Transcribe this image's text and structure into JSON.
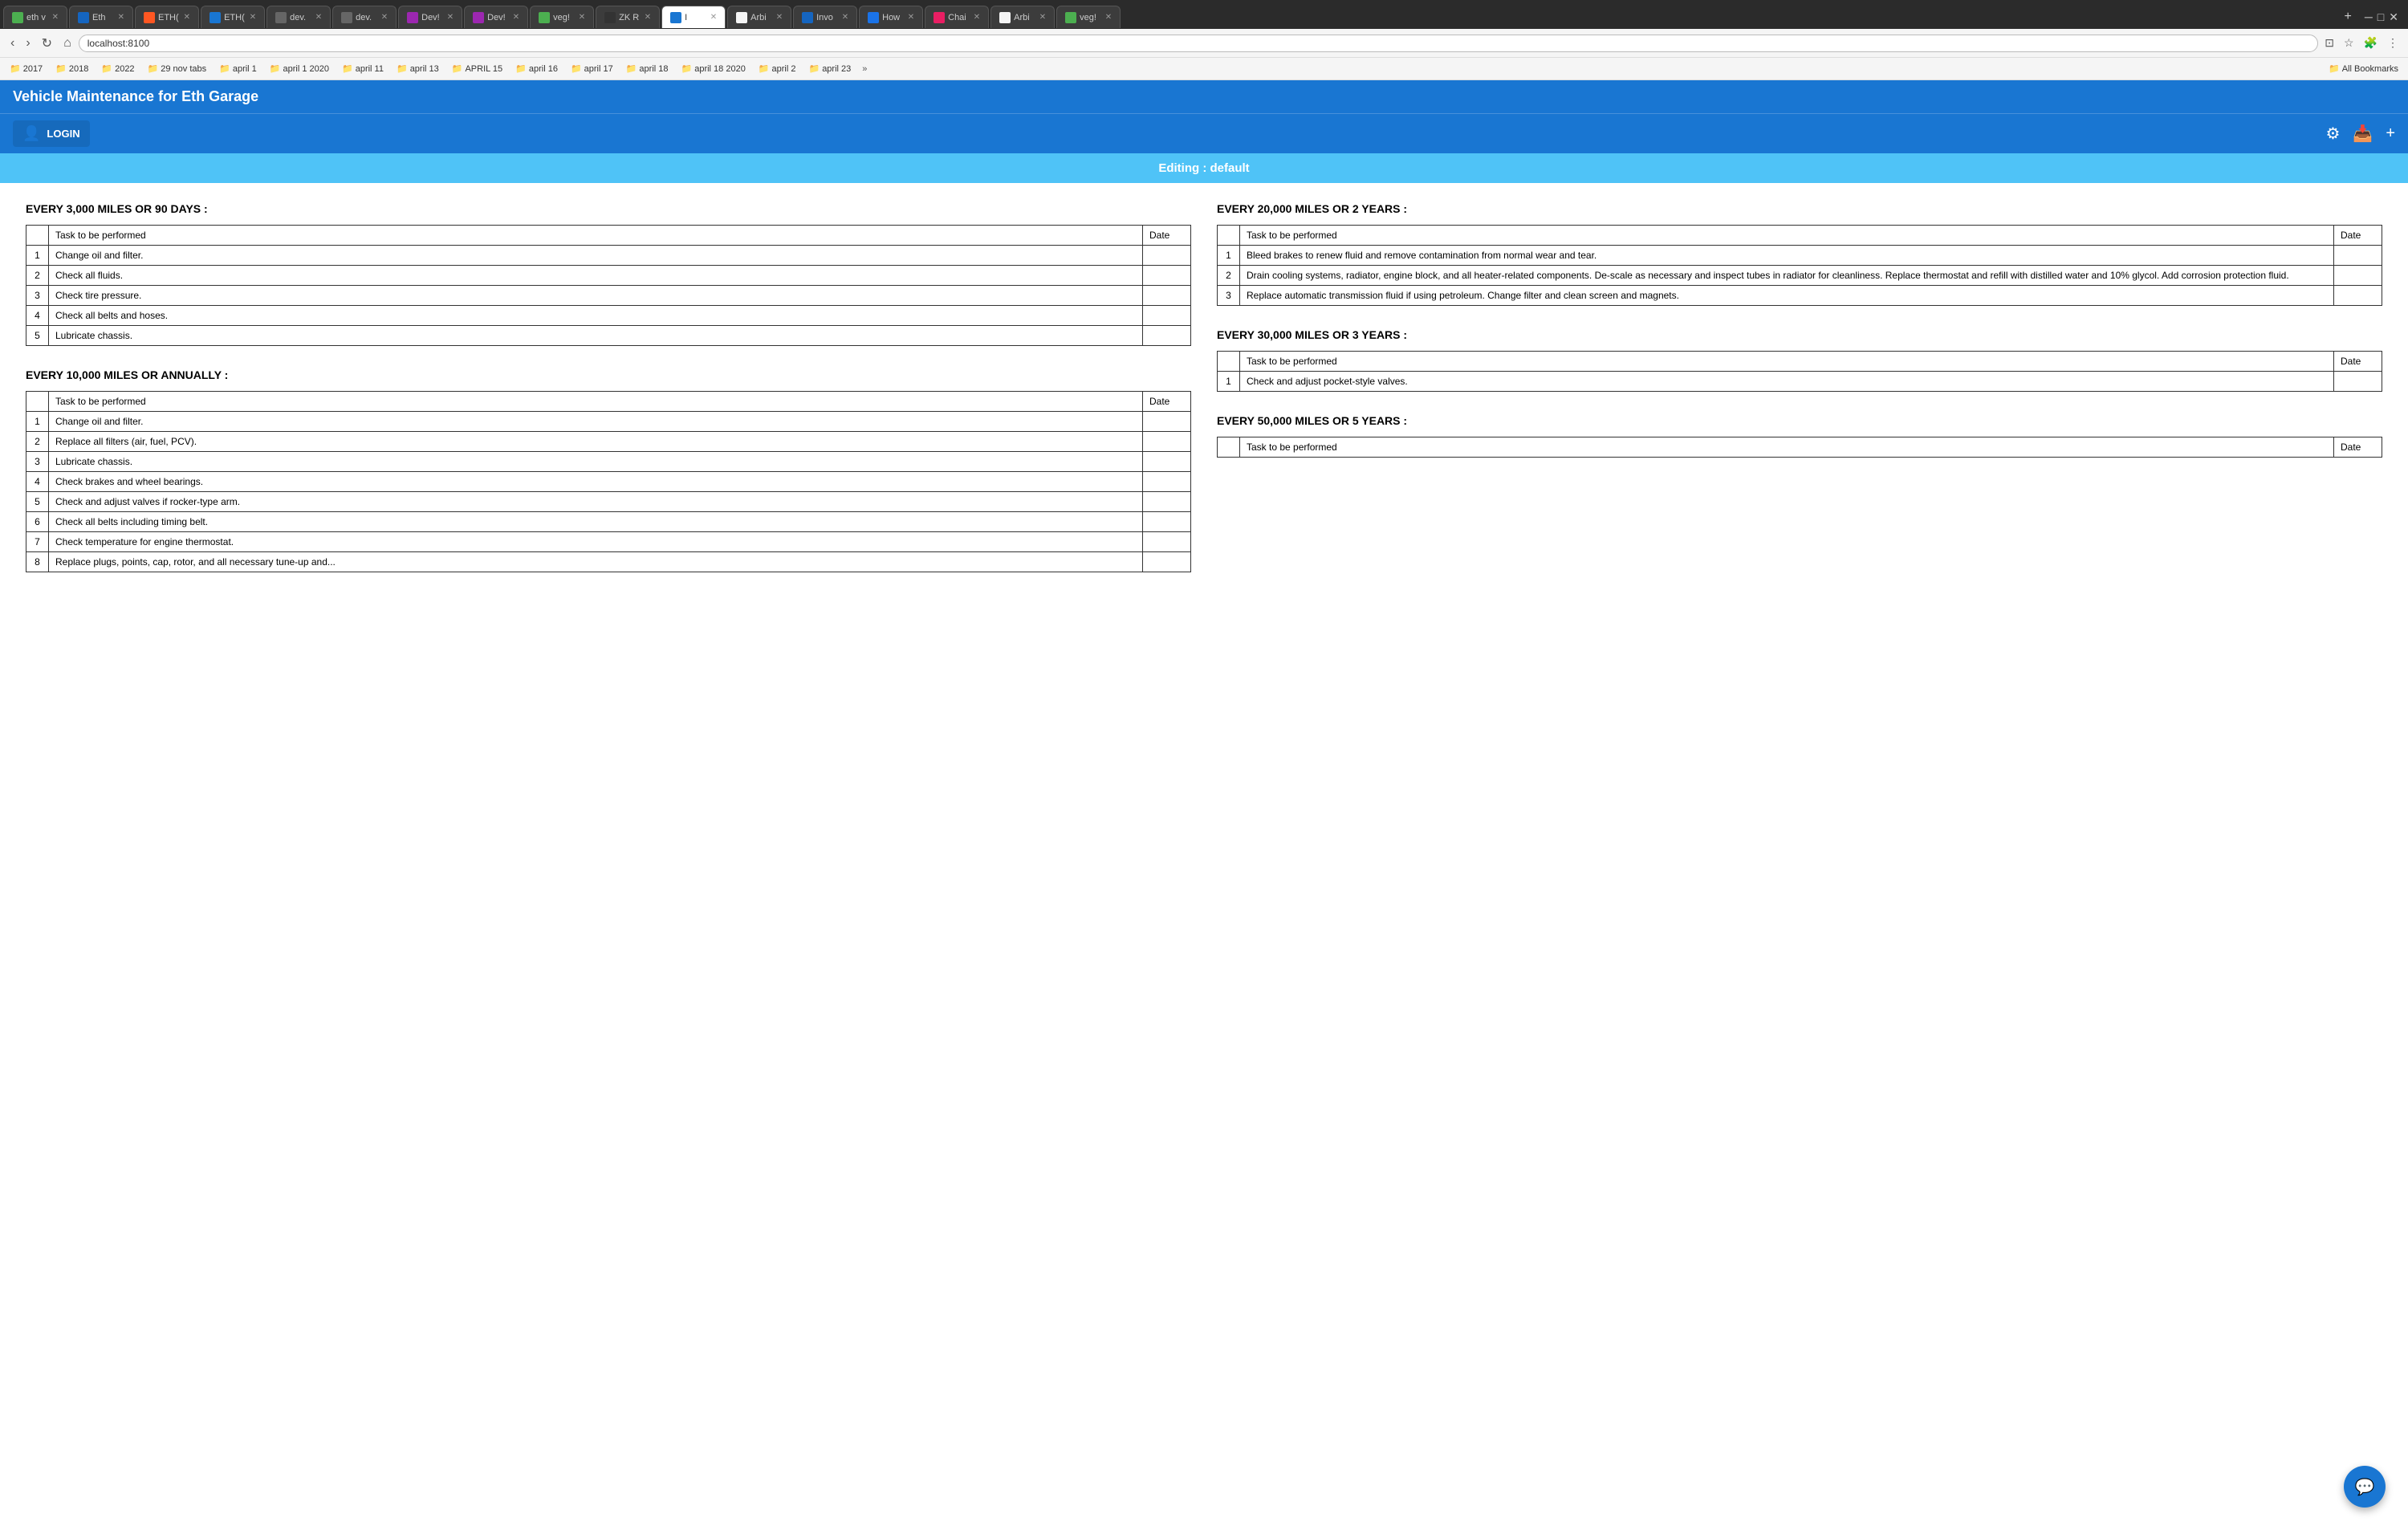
{
  "browser": {
    "tabs": [
      {
        "label": "eth v",
        "active": false,
        "favicon_color": "#4caf50"
      },
      {
        "label": "Eth",
        "active": false,
        "favicon_color": "#1565c0"
      },
      {
        "label": "ETH(",
        "active": false,
        "favicon_color": "#ff5722"
      },
      {
        "label": "ETH(",
        "active": false,
        "favicon_color": "#1976d2"
      },
      {
        "label": "dev.",
        "active": false,
        "favicon_color": "#666"
      },
      {
        "label": "dev.",
        "active": false,
        "favicon_color": "#666"
      },
      {
        "label": "Dev!",
        "active": false,
        "favicon_color": "#9c27b0"
      },
      {
        "label": "Dev!",
        "active": false,
        "favicon_color": "#9c27b0"
      },
      {
        "label": "veg!",
        "active": false,
        "favicon_color": "#4caf50"
      },
      {
        "label": "ZK R",
        "active": false,
        "favicon_color": "#333"
      },
      {
        "label": "I",
        "active": true,
        "favicon_color": "#1976d2"
      },
      {
        "label": "Arbi",
        "active": false,
        "favicon_color": "#f5f5f5"
      },
      {
        "label": "Invo",
        "active": false,
        "favicon_color": "#1565c0"
      },
      {
        "label": "How",
        "active": false,
        "favicon_color": "#1a73e8"
      },
      {
        "label": "Chai",
        "active": false,
        "favicon_color": "#e91e63"
      },
      {
        "label": "Arbi",
        "active": false,
        "favicon_color": "#f5f5f5"
      },
      {
        "label": "veg!",
        "active": false,
        "favicon_color": "#4caf50"
      }
    ],
    "address": "localhost:8100",
    "bookmarks": [
      "2017",
      "2018",
      "2022",
      "29 nov tabs",
      "april 1",
      "april 1 2020",
      "april 11",
      "april 13",
      "APRIL 15",
      "april 16",
      "april 17",
      "april 18",
      "april 18 2020",
      "april 2",
      "april 23"
    ],
    "all_bookmarks_label": "All Bookmarks"
  },
  "app": {
    "title": "Vehicle Maintenance for Eth Garage",
    "login_label": "LOGIN",
    "editing_label": "Editing : default"
  },
  "sections": [
    {
      "title": "EVERY 3,000 MILES OR 90 DAYS :",
      "headers": [
        "",
        "Task to be performed",
        "Date"
      ],
      "rows": [
        {
          "num": "1",
          "task": "Change oil and filter.",
          "date": ""
        },
        {
          "num": "2",
          "task": "Check all fluids.",
          "date": ""
        },
        {
          "num": "3",
          "task": "Check tire pressure.",
          "date": ""
        },
        {
          "num": "4",
          "task": "Check all belts and hoses.",
          "date": ""
        },
        {
          "num": "5",
          "task": "Lubricate chassis.",
          "date": ""
        }
      ]
    },
    {
      "title": "EVERY 10,000 MILES OR ANNUALLY :",
      "headers": [
        "",
        "Task to be performed",
        "Date"
      ],
      "rows": [
        {
          "num": "1",
          "task": "Change oil and filter.",
          "date": ""
        },
        {
          "num": "2",
          "task": "Replace all filters (air, fuel, PCV).",
          "date": ""
        },
        {
          "num": "3",
          "task": "Lubricate chassis.",
          "date": ""
        },
        {
          "num": "4",
          "task": "Check brakes and wheel bearings.",
          "date": ""
        },
        {
          "num": "5",
          "task": "Check and adjust valves if rocker-type arm.",
          "date": ""
        },
        {
          "num": "6",
          "task": "Check all belts including timing belt.",
          "date": ""
        },
        {
          "num": "7",
          "task": "Check temperature for engine thermostat.",
          "date": ""
        },
        {
          "num": "8",
          "task": "Replace plugs, points, cap, rotor, and all necessary tune-up and...",
          "date": ""
        }
      ]
    },
    {
      "title": "EVERY 20,000 MILES OR 2 YEARS :",
      "headers": [
        "",
        "Task to be performed",
        "Date"
      ],
      "rows": [
        {
          "num": "1",
          "task": "Bleed brakes to renew fluid and remove contamination from normal wear and tear.",
          "date": ""
        },
        {
          "num": "2",
          "task": "Drain cooling systems, radiator, engine block, and all heater-related components. De-scale as necessary and inspect tubes in radiator for cleanliness. Replace thermostat and refill with distilled water and 10% glycol. Add corrosion protection fluid.",
          "date": ""
        },
        {
          "num": "3",
          "task": "Replace automatic transmission fluid if using petroleum. Change filter and clean screen and magnets.",
          "date": ""
        }
      ]
    },
    {
      "title": "EVERY 30,000 MILES OR 3 YEARS :",
      "headers": [
        "",
        "Task to be performed",
        "Date"
      ],
      "rows": [
        {
          "num": "1",
          "task": "Check and adjust pocket-style valves.",
          "date": ""
        }
      ]
    },
    {
      "title": "EVERY 50,000 MILES OR 5 YEARS :",
      "headers": [
        "",
        "Task to be performed",
        "Date"
      ],
      "rows": []
    }
  ],
  "fab": {
    "icon": "💬"
  }
}
